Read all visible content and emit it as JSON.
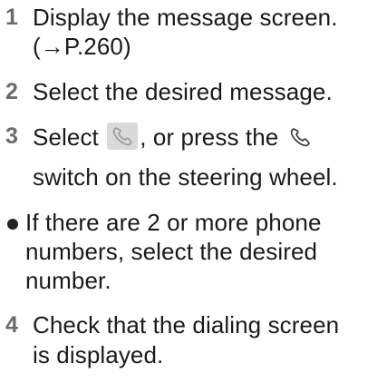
{
  "steps": [
    {
      "num": "1",
      "lines": [
        "Display the message screen.",
        "(→P.260)"
      ]
    },
    {
      "num": "2",
      "lines": [
        "Select the desired message."
      ]
    },
    {
      "num": "3",
      "pre": "Select",
      "post": ", or press the",
      "line2": "switch on the steering wheel.",
      "icon_button": "phone-button-icon",
      "icon_switch": "phone-switch-icon"
    },
    {
      "num": "4",
      "lines": [
        "Check that the dialing screen",
        "is displayed."
      ]
    }
  ],
  "note": {
    "lines": [
      "If there are 2 or more phone",
      "numbers, select the desired",
      "number."
    ]
  },
  "colors": {
    "step_number": "#6b6b6b",
    "button_bg": "#d9d9d9",
    "text": "#1a1a1a"
  }
}
